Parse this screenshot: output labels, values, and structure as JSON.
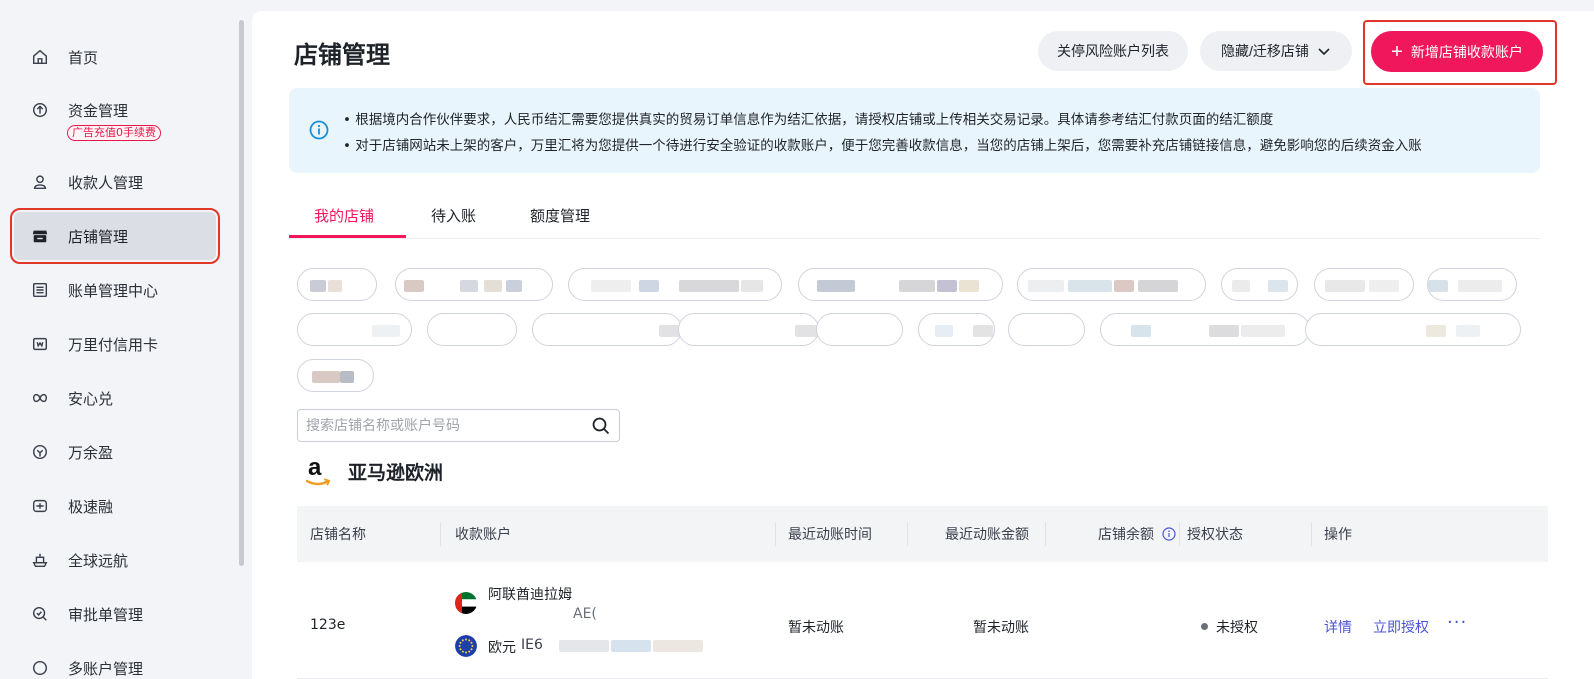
{
  "sidebar": {
    "items": [
      {
        "label": "首页",
        "icon": "home-icon"
      },
      {
        "label": "资金管理",
        "icon": "funds-icon",
        "badge": "广告充值0手续费"
      },
      {
        "label": "收款人管理",
        "icon": "payee-icon"
      },
      {
        "label": "店铺管理",
        "icon": "store-icon",
        "active": true
      },
      {
        "label": "账单管理中心",
        "icon": "bill-icon"
      },
      {
        "label": "万里付信用卡",
        "icon": "credit-card-icon"
      },
      {
        "label": "安心兑",
        "icon": "exchange-icon"
      },
      {
        "label": "万余盈",
        "icon": "yield-icon"
      },
      {
        "label": "极速融",
        "icon": "finance-icon"
      },
      {
        "label": "全球远航",
        "icon": "ship-icon"
      },
      {
        "label": "审批单管理",
        "icon": "approval-icon"
      },
      {
        "label": "多账户管理",
        "icon": "multi-account-icon"
      }
    ]
  },
  "header": {
    "title": "店铺管理",
    "risk_list_label": "关停风险账户列表",
    "hide_migrate_label": "隐藏/迁移店铺",
    "new_account_label": "新增店铺收款账户"
  },
  "notice": {
    "line1": "• 根据境内合作伙伴要求，人民币结汇需要您提供真实的贸易订单信息作为结汇依据，请授权店铺或上传相关交易记录。具体请参考结汇付款页面的结汇额度",
    "line2": "• 对于店铺网站未上架的客户，万里汇将为您提供一个待进行安全验证的收款账户，便于您完善收款信息，当您的店铺上架后，您需要补充店铺链接信息，避免影响您的后续资金入账"
  },
  "tabs": [
    {
      "label": "我的店铺",
      "active": true
    },
    {
      "label": "待入账"
    },
    {
      "label": "额度管理"
    }
  ],
  "search": {
    "placeholder": "搜索店铺名称或账户号码",
    "value": ""
  },
  "section": {
    "platform": "亚马逊欧洲"
  },
  "table": {
    "columns": [
      "店铺名称",
      "收款账户",
      "最近动账时间",
      "最近动账金额",
      "店铺余额",
      "授权状态",
      "操作"
    ],
    "rows": [
      {
        "store_name": "123e",
        "accounts": [
          {
            "currency": "阿联酋迪拉姆",
            "prefix": "AE("
          },
          {
            "currency": "欧元",
            "prefix": "IE6"
          }
        ],
        "last_time": "暂未动账",
        "last_amount": "暂未动账",
        "balance": "",
        "auth_status": "未授权",
        "actions": {
          "detail": "详情",
          "authorize": "立即授权",
          "more": "···"
        }
      }
    ]
  },
  "colors": {
    "accent": "#f0175c",
    "link": "#4a54d6",
    "notice_bg": "#e8f5fc",
    "highlight_box": "#e0372a"
  }
}
